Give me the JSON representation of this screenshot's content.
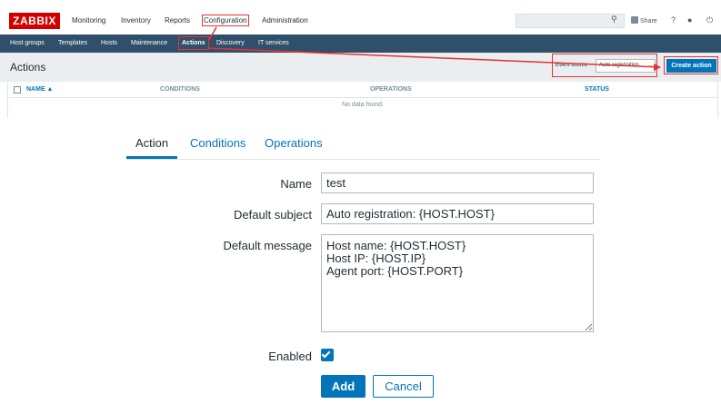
{
  "app": {
    "logo": "ZABBIX",
    "top_nav": [
      "Monitoring",
      "Inventory",
      "Reports",
      "Configuration",
      "Administration"
    ],
    "share_label": "Share",
    "help_icon": "?",
    "user_icon": "user-icon",
    "logout_icon": "power-icon"
  },
  "sub_nav": [
    "Host groups",
    "Templates",
    "Hosts",
    "Maintenance",
    "Actions",
    "Discovery",
    "IT services"
  ],
  "header": {
    "title": "Actions",
    "event_source_label": "Event source",
    "event_source_value": "Auto registration",
    "create_button": "Create action"
  },
  "table": {
    "columns": [
      "NAME ▲",
      "CONDITIONS",
      "OPERATIONS",
      "STATUS"
    ],
    "empty_message": "No data found."
  },
  "form": {
    "tabs": [
      "Action",
      "Conditions",
      "Operations"
    ],
    "name_label": "Name",
    "name_value": "test",
    "subject_label": "Default subject",
    "subject_value": "Auto registration: {HOST.HOST}",
    "message_label": "Default message",
    "message_value": "Host name: {HOST.HOST}\nHost IP: {HOST.IP}\nAgent port: {HOST.PORT}",
    "enabled_label": "Enabled",
    "enabled": true,
    "add_button": "Add",
    "cancel_button": "Cancel"
  },
  "colors": {
    "brand_red": "#d40000",
    "nav_dark": "#2f4f6a",
    "accent_blue": "#0275b8",
    "annotation_red": "#e53232"
  }
}
